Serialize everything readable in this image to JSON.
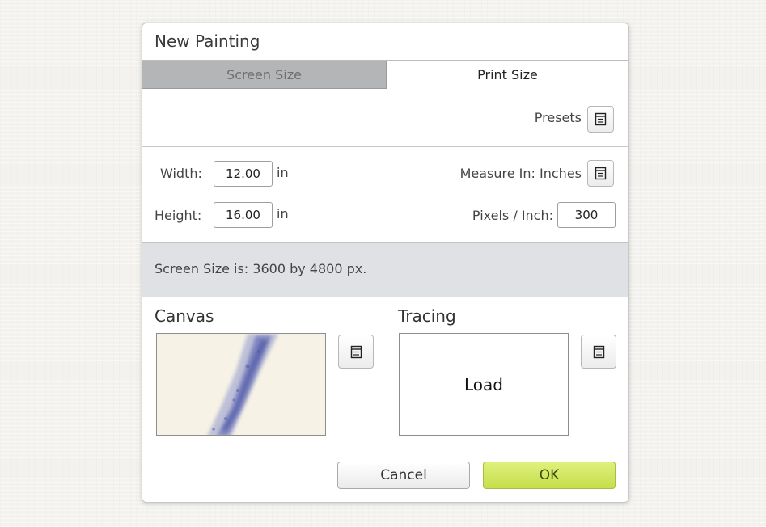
{
  "dialog": {
    "title": "New Painting",
    "tabs": [
      {
        "label": "Screen Size",
        "active": false
      },
      {
        "label": "Print Size",
        "active": true
      }
    ],
    "presets_label": "Presets",
    "width": {
      "label": "Width:",
      "value": "12.00",
      "unit": "in"
    },
    "height": {
      "label": "Height:",
      "value": "16.00",
      "unit": "in"
    },
    "measure_in": {
      "label": "Measure In: Inches"
    },
    "ppi": {
      "label": "Pixels / Inch:",
      "value": "300"
    },
    "screen_size_text": "Screen Size is: 3600 by 4800 px.",
    "canvas": {
      "title": "Canvas"
    },
    "tracing": {
      "title": "Tracing",
      "load_label": "Load"
    },
    "buttons": {
      "cancel": "Cancel",
      "ok": "OK"
    }
  },
  "colors": {
    "ok_button": "#cde45a",
    "inactive_tab": "#b4b5b7",
    "info_band": "#dfe1e5"
  },
  "icons": [
    "list-menu-icon"
  ]
}
